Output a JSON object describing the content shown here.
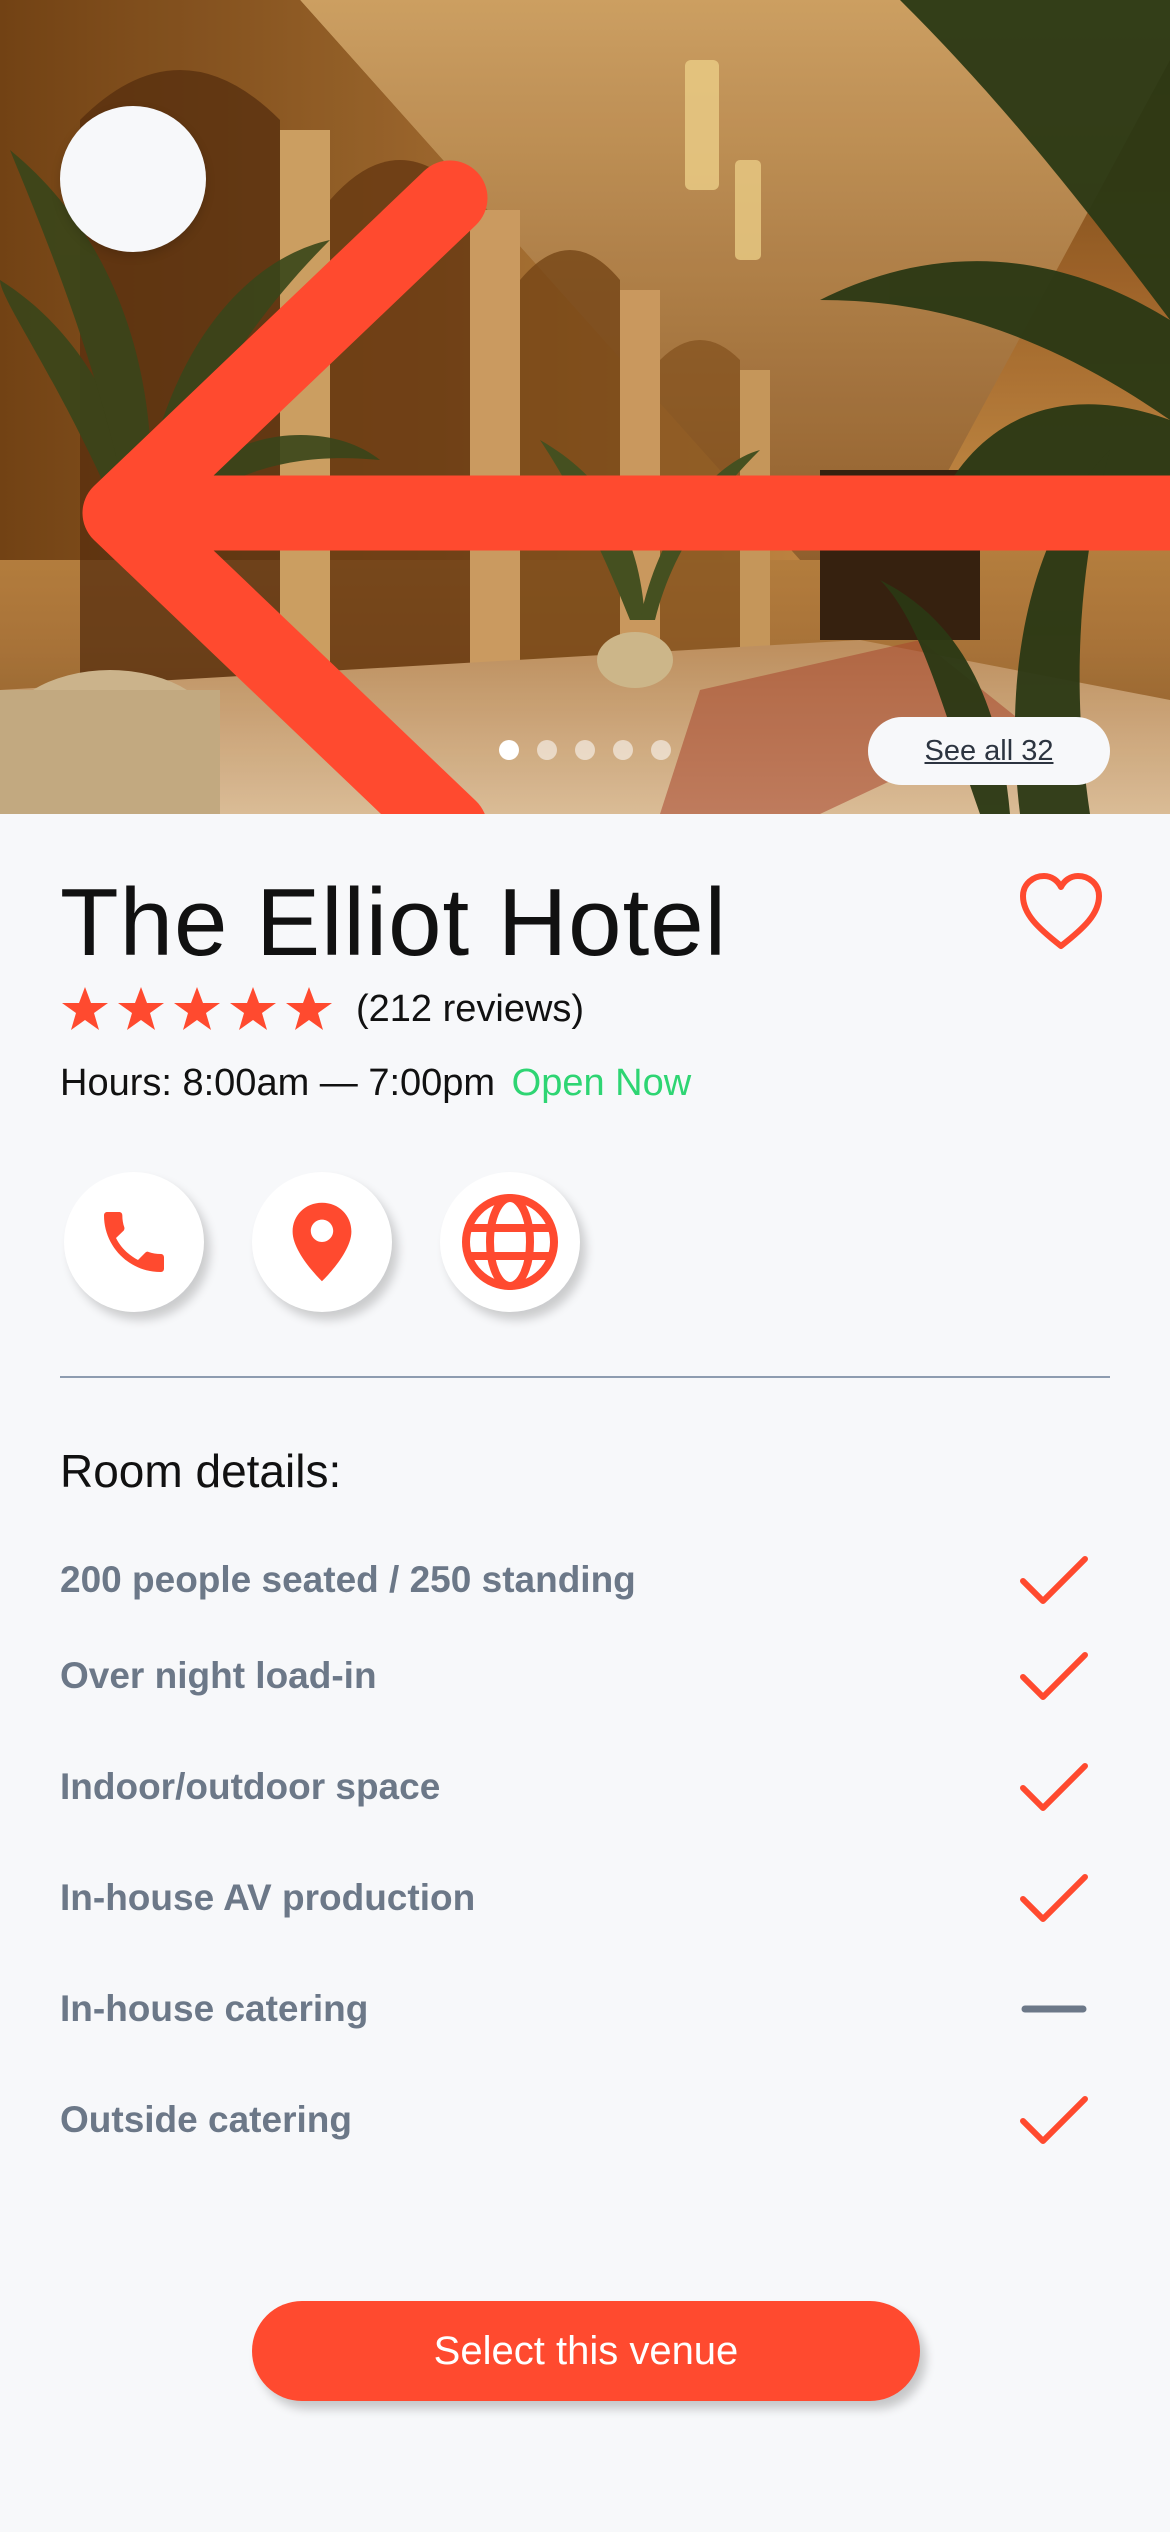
{
  "hero": {
    "image_alt": "Hotel corridor with arches, chandeliers and palm plants",
    "see_all_label": "See all 32",
    "slide_count": 5,
    "active_slide": 1
  },
  "venue": {
    "name": "The Elliot Hotel",
    "rating": 5,
    "reviews_label": "(212 reviews)",
    "hours_label": "Hours: 8:00am — 7:00pm",
    "status_label": "Open Now"
  },
  "actions": [
    {
      "name": "phone-icon"
    },
    {
      "name": "location-pin-icon"
    },
    {
      "name": "globe-icon"
    }
  ],
  "room_details": {
    "title": "Room details:",
    "items": [
      {
        "label": "200 people seated / 250 standing",
        "available": true
      },
      {
        "label": "Over night load-in",
        "available": true
      },
      {
        "label": "Indoor/outdoor space",
        "available": true
      },
      {
        "label": "In-house AV production",
        "available": true
      },
      {
        "label": "In-house catering",
        "available": false
      },
      {
        "label": "Outside catering",
        "available": true
      }
    ]
  },
  "cta": {
    "label": "Select this venue"
  },
  "colors": {
    "accent": "#ff4a2f",
    "open_status": "#2ed573",
    "muted_text": "#6c7888",
    "background": "#f7f8fa"
  }
}
